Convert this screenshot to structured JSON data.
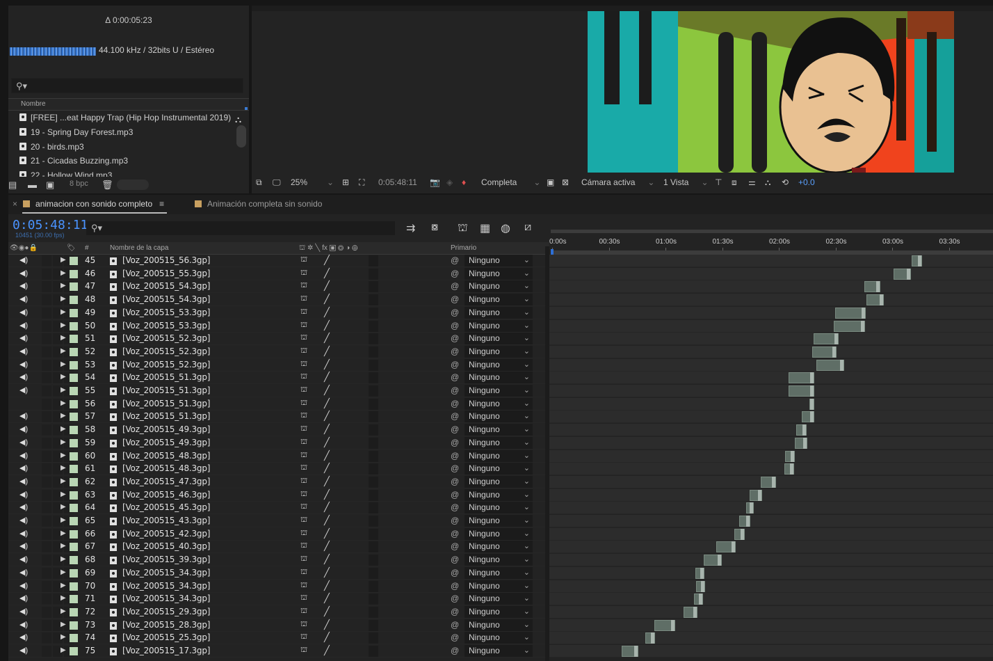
{
  "project": {
    "duration": "Δ 0:00:05:23",
    "audio_info": "44.100 kHz / 32bits U / Estéreo",
    "search_placeholder": "ϼ",
    "column_name": "Nombre",
    "items": [
      "[FREE] ...eat Happy Trap (Hip Hop Instrumental 2019)",
      "19 - Spring Day Forest.mp3",
      "20 - birds.mp3",
      "21 - Cicadas Buzzing.mp3",
      "22 - Hollow Wind.mp3"
    ],
    "bpc": "8 bpc"
  },
  "viewer": {
    "zoom": "25%",
    "timecode": "0:05:48:11",
    "resolution": "Completa",
    "camera": "Cámara activa",
    "views": "1 Vista",
    "exposure": "+0.0"
  },
  "timeline": {
    "tabs": [
      {
        "label": "animacion con sonido completo",
        "color": "#c8a060",
        "active": true
      },
      {
        "label": "Animación completa sin sonido",
        "color": "#c8a060",
        "active": false
      }
    ],
    "timecode": "0:05:48:11",
    "frame_info": "10451 (30.00 fps)",
    "columns": {
      "number": "#",
      "layer_name": "Nombre de la capa",
      "parent": "Primario"
    },
    "ruler_ticks": [
      "0:00s",
      "00:30s",
      "01:00s",
      "01:30s",
      "02:00s",
      "02:30s",
      "03:00s",
      "03:30s"
    ],
    "layers": [
      {
        "num": "45",
        "name": "[Voz_200515_56.3gp]",
        "parent": "Ninguno",
        "audio": true,
        "start": 83.3,
        "dur": 2.4
      },
      {
        "num": "46",
        "name": "[Voz_200515_55.3gp]",
        "parent": "Ninguno",
        "audio": true,
        "start": 79.2,
        "dur": 4.0
      },
      {
        "num": "47",
        "name": "[Voz_200515_54.3gp]",
        "parent": "Ninguno",
        "audio": true,
        "start": 72.5,
        "dur": 3.6
      },
      {
        "num": "48",
        "name": "[Voz_200515_54.3gp]",
        "parent": "Ninguno",
        "audio": true,
        "start": 72.9,
        "dur": 4.0
      },
      {
        "num": "49",
        "name": "[Voz_200515_53.3gp]",
        "parent": "Ninguno",
        "audio": true,
        "start": 65.8,
        "dur": 7.0
      },
      {
        "num": "50",
        "name": "[Voz_200515_53.3gp]",
        "parent": "Ninguno",
        "audio": true,
        "start": 65.5,
        "dur": 7.2
      },
      {
        "num": "51",
        "name": "[Voz_200515_52.3gp]",
        "parent": "Ninguno",
        "audio": true,
        "start": 60.8,
        "dur": 5.8
      },
      {
        "num": "52",
        "name": "[Voz_200515_52.3gp]",
        "parent": "Ninguno",
        "audio": true,
        "start": 60.5,
        "dur": 5.6
      },
      {
        "num": "53",
        "name": "[Voz_200515_52.3gp]",
        "parent": "Ninguno",
        "audio": true,
        "start": 61.5,
        "dur": 6.3
      },
      {
        "num": "54",
        "name": "[Voz_200515_51.3gp]",
        "parent": "Ninguno",
        "audio": true,
        "start": 55.0,
        "dur": 6.0
      },
      {
        "num": "55",
        "name": "[Voz_200515_51.3gp]",
        "parent": "Ninguno",
        "audio": true,
        "start": 55.0,
        "dur": 6.0
      },
      {
        "num": "56",
        "name": "[Voz_200515_51.3gp]",
        "parent": "Ninguno",
        "audio": false,
        "start": 59.8,
        "dur": 1.2
      },
      {
        "num": "57",
        "name": "[Voz_200515_51.3gp]",
        "parent": "Ninguno",
        "audio": true,
        "start": 58.0,
        "dur": 3.0
      },
      {
        "num": "58",
        "name": "[Voz_200515_49.3gp]",
        "parent": "Ninguno",
        "audio": true,
        "start": 56.8,
        "dur": 2.4
      },
      {
        "num": "59",
        "name": "[Voz_200515_49.3gp]",
        "parent": "Ninguno",
        "audio": true,
        "start": 56.5,
        "dur": 2.8
      },
      {
        "num": "60",
        "name": "[Voz_200515_48.3gp]",
        "parent": "Ninguno",
        "audio": true,
        "start": 54.2,
        "dur": 2.2
      },
      {
        "num": "61",
        "name": "[Voz_200515_48.3gp]",
        "parent": "Ninguno",
        "audio": true,
        "start": 54.0,
        "dur": 2.3
      },
      {
        "num": "62",
        "name": "[Voz_200515_47.3gp]",
        "parent": "Ninguno",
        "audio": true,
        "start": 48.6,
        "dur": 3.6
      },
      {
        "num": "63",
        "name": "[Voz_200515_46.3gp]",
        "parent": "Ninguno",
        "audio": true,
        "start": 46.0,
        "dur": 2.9
      },
      {
        "num": "64",
        "name": "[Voz_200515_45.3gp]",
        "parent": "Ninguno",
        "audio": true,
        "start": 45.2,
        "dur": 1.9
      },
      {
        "num": "65",
        "name": "[Voz_200515_43.3gp]",
        "parent": "Ninguno",
        "audio": true,
        "start": 43.6,
        "dur": 2.6
      },
      {
        "num": "66",
        "name": "[Voz_200515_42.3gp]",
        "parent": "Ninguno",
        "audio": true,
        "start": 42.6,
        "dur": 2.4
      },
      {
        "num": "67",
        "name": "[Voz_200515_40.3gp]",
        "parent": "Ninguno",
        "audio": true,
        "start": 38.4,
        "dur": 4.5
      },
      {
        "num": "68",
        "name": "[Voz_200515_39.3gp]",
        "parent": "Ninguno",
        "audio": true,
        "start": 35.5,
        "dur": 4.2
      },
      {
        "num": "69",
        "name": "[Voz_200515_34.3gp]",
        "parent": "Ninguno",
        "audio": true,
        "start": 33.6,
        "dur": 2.0
      },
      {
        "num": "70",
        "name": "[Voz_200515_34.3gp]",
        "parent": "Ninguno",
        "audio": true,
        "start": 33.8,
        "dur": 2.1
      },
      {
        "num": "71",
        "name": "[Voz_200515_34.3gp]",
        "parent": "Ninguno",
        "audio": true,
        "start": 33.2,
        "dur": 2.2
      },
      {
        "num": "72",
        "name": "[Voz_200515_29.3gp]",
        "parent": "Ninguno",
        "audio": true,
        "start": 30.9,
        "dur": 3.2
      },
      {
        "num": "73",
        "name": "[Voz_200515_28.3gp]",
        "parent": "Ninguno",
        "audio": true,
        "start": 24.2,
        "dur": 4.7
      },
      {
        "num": "74",
        "name": "[Voz_200515_25.3gp]",
        "parent": "Ninguno",
        "audio": true,
        "start": 22.0,
        "dur": 2.3
      },
      {
        "num": "75",
        "name": "[Voz_200515_17.3gp]",
        "parent": "Ninguno",
        "audio": true,
        "start": 16.6,
        "dur": 3.8
      }
    ]
  }
}
